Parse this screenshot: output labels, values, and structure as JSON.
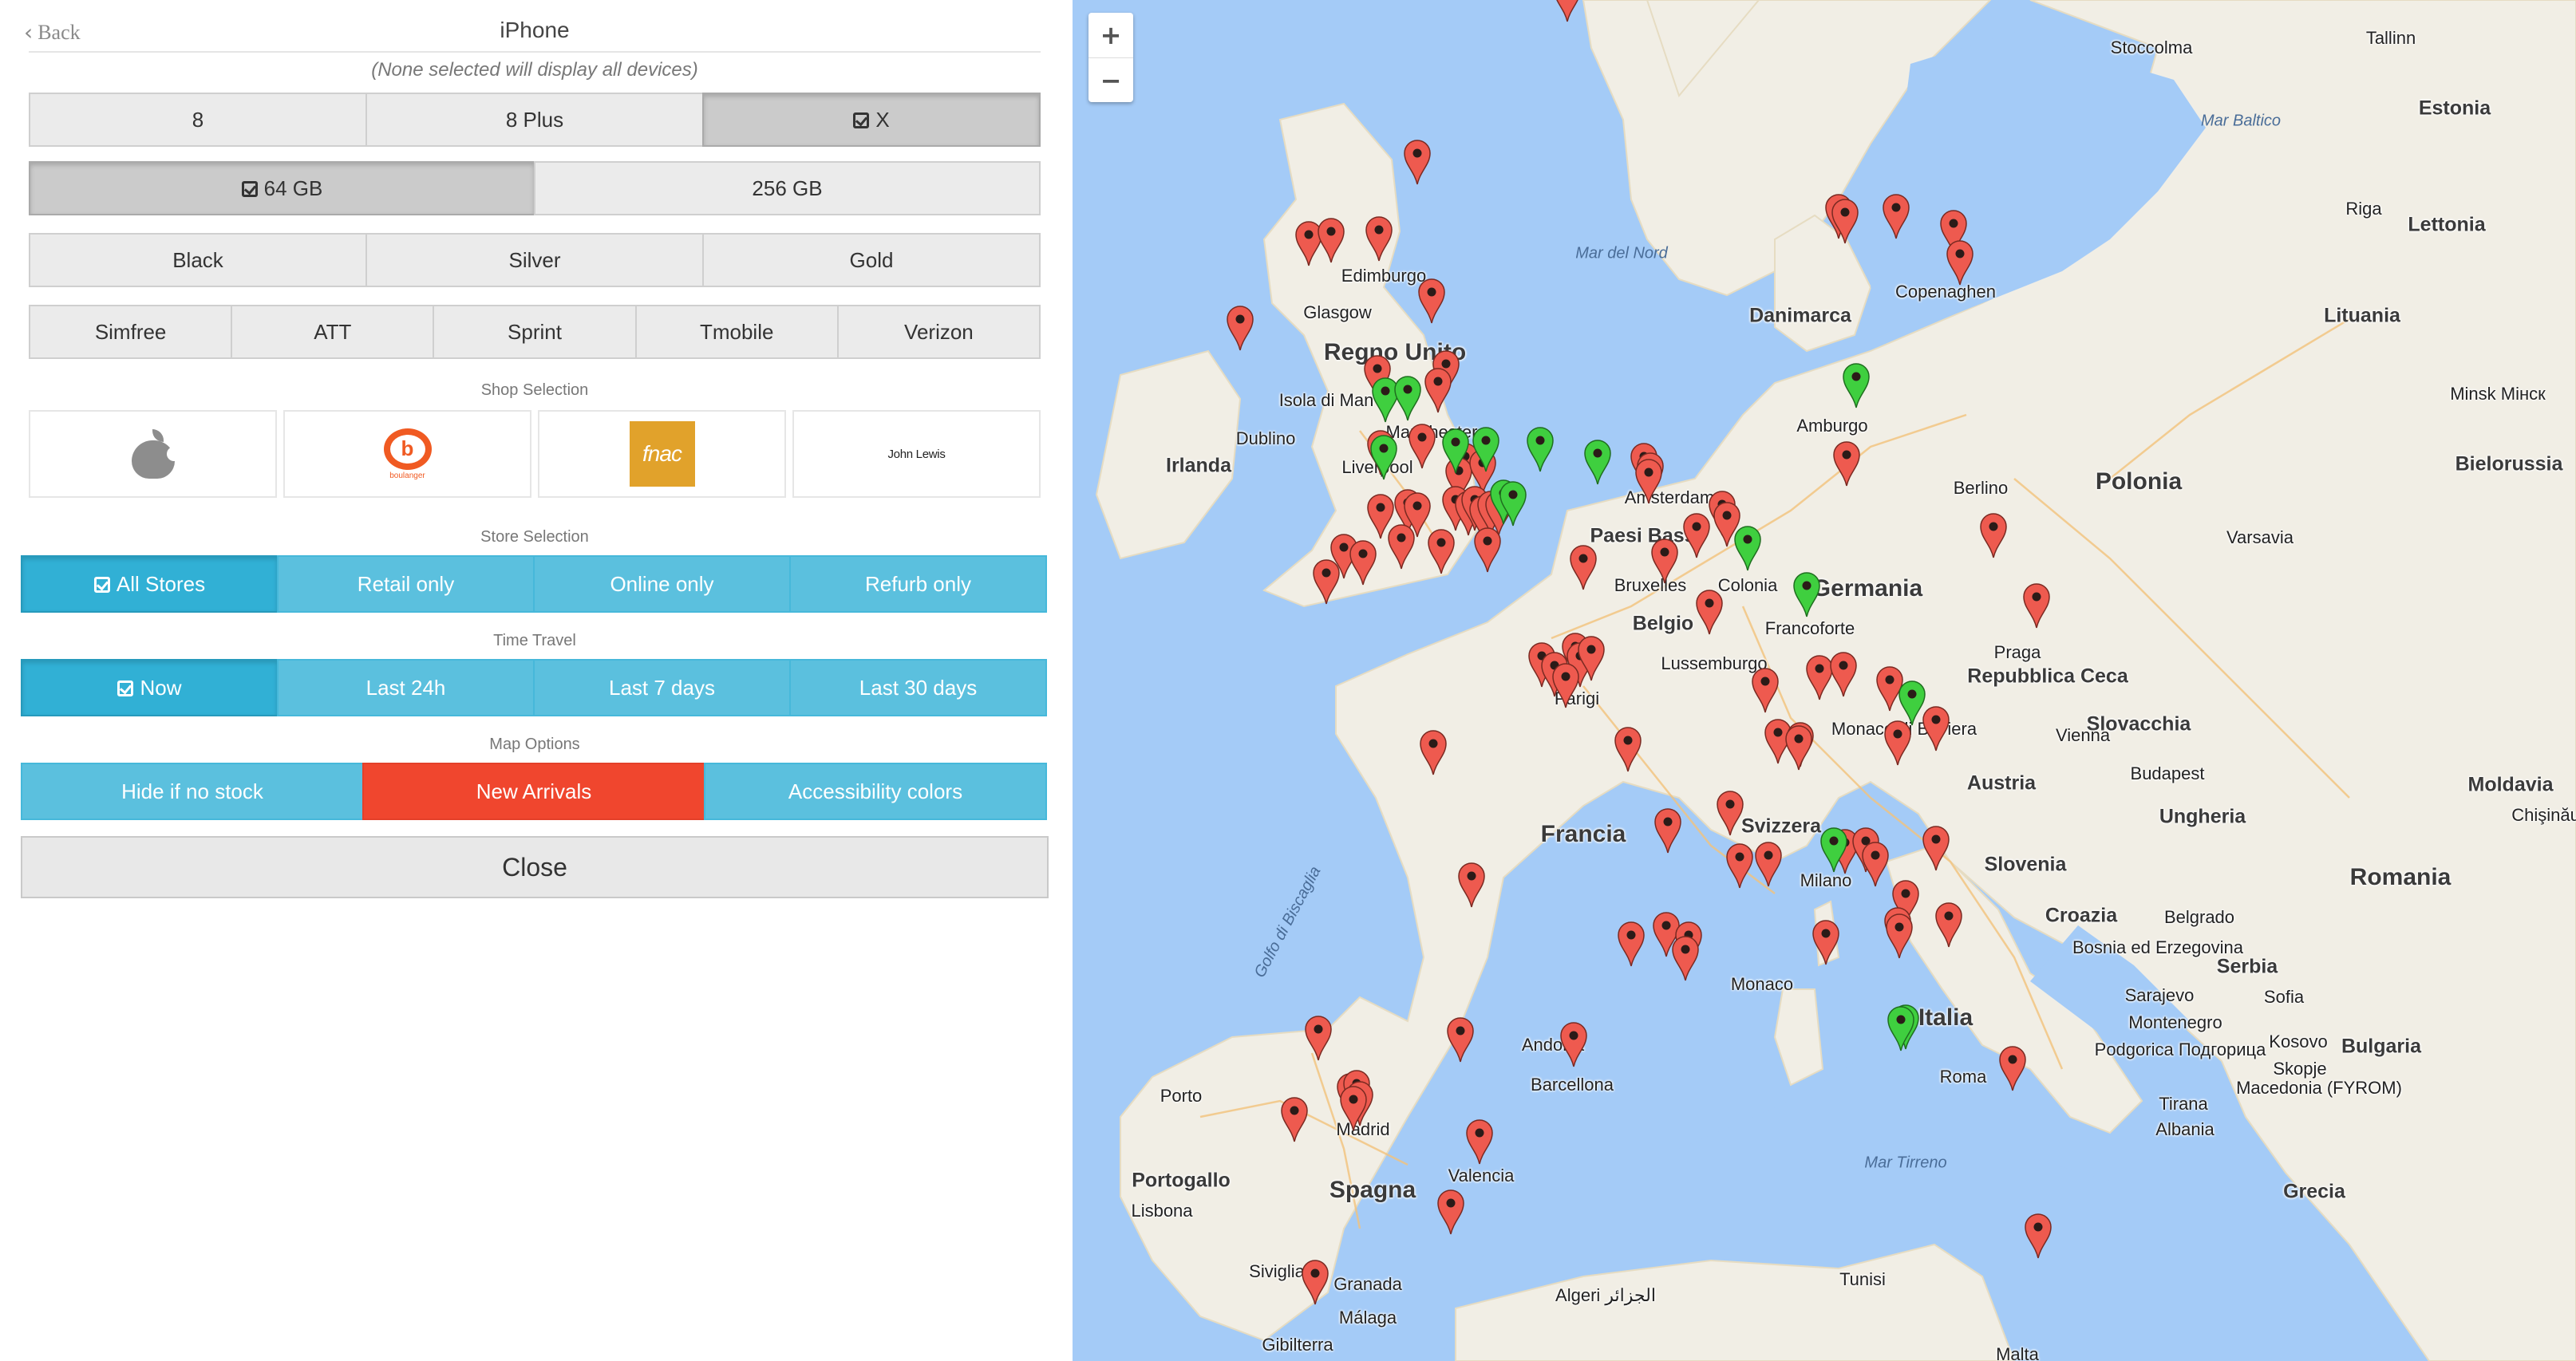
{
  "header": {
    "back_label": "Back",
    "title": "iPhone",
    "hint": "(None selected will display all devices)"
  },
  "models": [
    {
      "label": "8",
      "selected": false
    },
    {
      "label": "8 Plus",
      "selected": false
    },
    {
      "label": "X",
      "selected": true
    }
  ],
  "capacities": [
    {
      "label": "64 GB",
      "selected": true
    },
    {
      "label": "256 GB",
      "selected": false
    }
  ],
  "colors": [
    {
      "label": "Black",
      "selected": false
    },
    {
      "label": "Silver",
      "selected": false
    },
    {
      "label": "Gold",
      "selected": false
    }
  ],
  "carriers": [
    {
      "label": "Simfree",
      "selected": false
    },
    {
      "label": "ATT",
      "selected": false
    },
    {
      "label": "Sprint",
      "selected": false
    },
    {
      "label": "Tmobile",
      "selected": false
    },
    {
      "label": "Verizon",
      "selected": false
    }
  ],
  "shop_selection": {
    "title": "Shop Selection",
    "shops": [
      {
        "name": "apple",
        "icon": "apple-logo-icon"
      },
      {
        "name": "boulanger",
        "logo_text": "boulanger",
        "icon": "boulanger-logo-icon"
      },
      {
        "name": "fnac",
        "logo_text": "fnac",
        "icon": "fnac-logo-icon"
      },
      {
        "name": "john-lewis",
        "logo_text": "John Lewis",
        "icon": "john-lewis-logo-icon"
      }
    ]
  },
  "store_selection": {
    "title": "Store Selection",
    "options": [
      {
        "label": "All Stores",
        "selected": true
      },
      {
        "label": "Retail only",
        "selected": false
      },
      {
        "label": "Online only",
        "selected": false
      },
      {
        "label": "Refurb only",
        "selected": false
      }
    ]
  },
  "time_travel": {
    "title": "Time Travel",
    "options": [
      {
        "label": "Now",
        "selected": true
      },
      {
        "label": "Last 24h",
        "selected": false
      },
      {
        "label": "Last 7 days",
        "selected": false
      },
      {
        "label": "Last 30 days",
        "selected": false
      }
    ]
  },
  "map_options": {
    "title": "Map Options",
    "options": [
      {
        "label": "Hide if no stock",
        "highlight": false
      },
      {
        "label": "New Arrivals",
        "highlight": true
      },
      {
        "label": "Accessibility colors",
        "highlight": false
      }
    ]
  },
  "close_label": "Close",
  "colors_theme": {
    "accent_blue": "#5bc0de",
    "accent_red": "#f0462e",
    "pin_red": "#ee5a4f",
    "pin_green": "#3fcf3f",
    "water": "#a4cbf7",
    "land": "#f1eee5"
  },
  "map": {
    "zoom_in": "+",
    "zoom_out": "−",
    "labels": {
      "countries": [
        "Regno Unito",
        "Irlanda",
        "Francia",
        "Spagna",
        "Germania",
        "Italia",
        "Polonia",
        "Romania",
        "Portogallo",
        "Paesi Bassi",
        "Belgio",
        "Svizzera",
        "Austria",
        "Danimarca",
        "Repubblica Ceca",
        "Slovacchia",
        "Ungheria",
        "Estonia",
        "Lettonia",
        "Lituania",
        "Bielorussia",
        "Moldavia",
        "Croazia",
        "Slovenia",
        "Serbia",
        "Bulgaria",
        "Grecia",
        "Albania",
        "Kosovo",
        "Montenegro",
        "Bosnia ed Erzegovina",
        "Macedonia (FYROM)",
        "Andorra",
        "Monaco",
        "Malta",
        "Lussemburgo"
      ],
      "cities": [
        "Stoccolma",
        "Tallinn",
        "Riga",
        "Minsk Мінск",
        "Varsavia",
        "Berlino",
        "Amburgo",
        "Copenaghen",
        "Edimburgo",
        "Glasgow",
        "Isola di Man",
        "Dublino",
        "Liverpool",
        "Manchester",
        "Amsterdam",
        "Bruxelles",
        "Colonia",
        "Francoforte",
        "Praga",
        "Vienna",
        "Monaco di Baviera",
        "Budapest",
        "Chişinău",
        "Parigi",
        "Milano",
        "Belgrado",
        "Sarajevo",
        "Podgorica Подгорица",
        "Sofia",
        "Skopje",
        "Tirana",
        "Roma",
        "Barcellona",
        "Valencia",
        "Madrid",
        "Porto",
        "Lisbona",
        "Siviglia",
        "Granada",
        "Málaga",
        "Gibilterra",
        "Algeri الجزائر",
        "Tunisi"
      ],
      "seas": [
        "Mar Baltico",
        "Mar del Nord",
        "Golfo di Biscaglia",
        "Mar Tirreno"
      ]
    },
    "pins_red_count": 95,
    "pins_green_count": 14
  }
}
